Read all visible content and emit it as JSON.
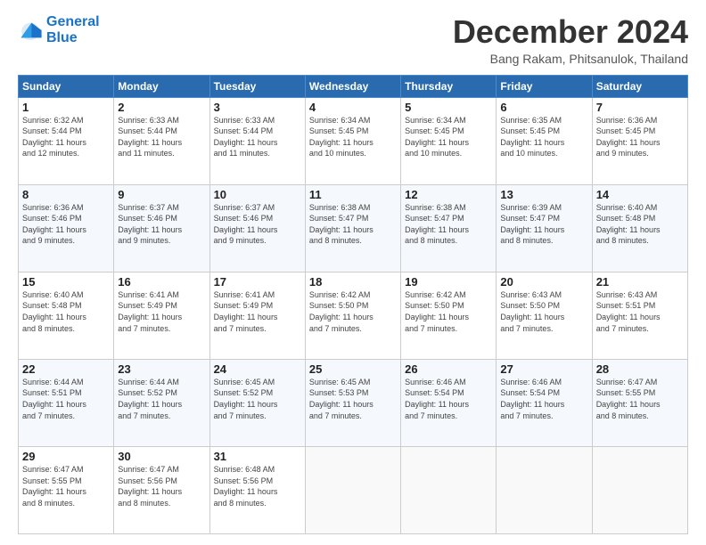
{
  "header": {
    "logo_line1": "General",
    "logo_line2": "Blue",
    "month_title": "December 2024",
    "location": "Bang Rakam, Phitsanulok, Thailand"
  },
  "days_of_week": [
    "Sunday",
    "Monday",
    "Tuesday",
    "Wednesday",
    "Thursday",
    "Friday",
    "Saturday"
  ],
  "weeks": [
    [
      {
        "day": "1",
        "sunrise": "6:32 AM",
        "sunset": "5:44 PM",
        "daylight": "11 hours and 12 minutes."
      },
      {
        "day": "2",
        "sunrise": "6:33 AM",
        "sunset": "5:44 PM",
        "daylight": "11 hours and 11 minutes."
      },
      {
        "day": "3",
        "sunrise": "6:33 AM",
        "sunset": "5:44 PM",
        "daylight": "11 hours and 11 minutes."
      },
      {
        "day": "4",
        "sunrise": "6:34 AM",
        "sunset": "5:45 PM",
        "daylight": "11 hours and 10 minutes."
      },
      {
        "day": "5",
        "sunrise": "6:34 AM",
        "sunset": "5:45 PM",
        "daylight": "11 hours and 10 minutes."
      },
      {
        "day": "6",
        "sunrise": "6:35 AM",
        "sunset": "5:45 PM",
        "daylight": "11 hours and 10 minutes."
      },
      {
        "day": "7",
        "sunrise": "6:36 AM",
        "sunset": "5:45 PM",
        "daylight": "11 hours and 9 minutes."
      }
    ],
    [
      {
        "day": "8",
        "sunrise": "6:36 AM",
        "sunset": "5:46 PM",
        "daylight": "11 hours and 9 minutes."
      },
      {
        "day": "9",
        "sunrise": "6:37 AM",
        "sunset": "5:46 PM",
        "daylight": "11 hours and 9 minutes."
      },
      {
        "day": "10",
        "sunrise": "6:37 AM",
        "sunset": "5:46 PM",
        "daylight": "11 hours and 9 minutes."
      },
      {
        "day": "11",
        "sunrise": "6:38 AM",
        "sunset": "5:47 PM",
        "daylight": "11 hours and 8 minutes."
      },
      {
        "day": "12",
        "sunrise": "6:38 AM",
        "sunset": "5:47 PM",
        "daylight": "11 hours and 8 minutes."
      },
      {
        "day": "13",
        "sunrise": "6:39 AM",
        "sunset": "5:47 PM",
        "daylight": "11 hours and 8 minutes."
      },
      {
        "day": "14",
        "sunrise": "6:40 AM",
        "sunset": "5:48 PM",
        "daylight": "11 hours and 8 minutes."
      }
    ],
    [
      {
        "day": "15",
        "sunrise": "6:40 AM",
        "sunset": "5:48 PM",
        "daylight": "11 hours and 8 minutes."
      },
      {
        "day": "16",
        "sunrise": "6:41 AM",
        "sunset": "5:49 PM",
        "daylight": "11 hours and 7 minutes."
      },
      {
        "day": "17",
        "sunrise": "6:41 AM",
        "sunset": "5:49 PM",
        "daylight": "11 hours and 7 minutes."
      },
      {
        "day": "18",
        "sunrise": "6:42 AM",
        "sunset": "5:50 PM",
        "daylight": "11 hours and 7 minutes."
      },
      {
        "day": "19",
        "sunrise": "6:42 AM",
        "sunset": "5:50 PM",
        "daylight": "11 hours and 7 minutes."
      },
      {
        "day": "20",
        "sunrise": "6:43 AM",
        "sunset": "5:50 PM",
        "daylight": "11 hours and 7 minutes."
      },
      {
        "day": "21",
        "sunrise": "6:43 AM",
        "sunset": "5:51 PM",
        "daylight": "11 hours and 7 minutes."
      }
    ],
    [
      {
        "day": "22",
        "sunrise": "6:44 AM",
        "sunset": "5:51 PM",
        "daylight": "11 hours and 7 minutes."
      },
      {
        "day": "23",
        "sunrise": "6:44 AM",
        "sunset": "5:52 PM",
        "daylight": "11 hours and 7 minutes."
      },
      {
        "day": "24",
        "sunrise": "6:45 AM",
        "sunset": "5:52 PM",
        "daylight": "11 hours and 7 minutes."
      },
      {
        "day": "25",
        "sunrise": "6:45 AM",
        "sunset": "5:53 PM",
        "daylight": "11 hours and 7 minutes."
      },
      {
        "day": "26",
        "sunrise": "6:46 AM",
        "sunset": "5:54 PM",
        "daylight": "11 hours and 7 minutes."
      },
      {
        "day": "27",
        "sunrise": "6:46 AM",
        "sunset": "5:54 PM",
        "daylight": "11 hours and 7 minutes."
      },
      {
        "day": "28",
        "sunrise": "6:47 AM",
        "sunset": "5:55 PM",
        "daylight": "11 hours and 8 minutes."
      }
    ],
    [
      {
        "day": "29",
        "sunrise": "6:47 AM",
        "sunset": "5:55 PM",
        "daylight": "11 hours and 8 minutes."
      },
      {
        "day": "30",
        "sunrise": "6:47 AM",
        "sunset": "5:56 PM",
        "daylight": "11 hours and 8 minutes."
      },
      {
        "day": "31",
        "sunrise": "6:48 AM",
        "sunset": "5:56 PM",
        "daylight": "11 hours and 8 minutes."
      },
      null,
      null,
      null,
      null
    ]
  ],
  "labels": {
    "sunrise": "Sunrise:",
    "sunset": "Sunset:",
    "daylight": "Daylight:"
  }
}
